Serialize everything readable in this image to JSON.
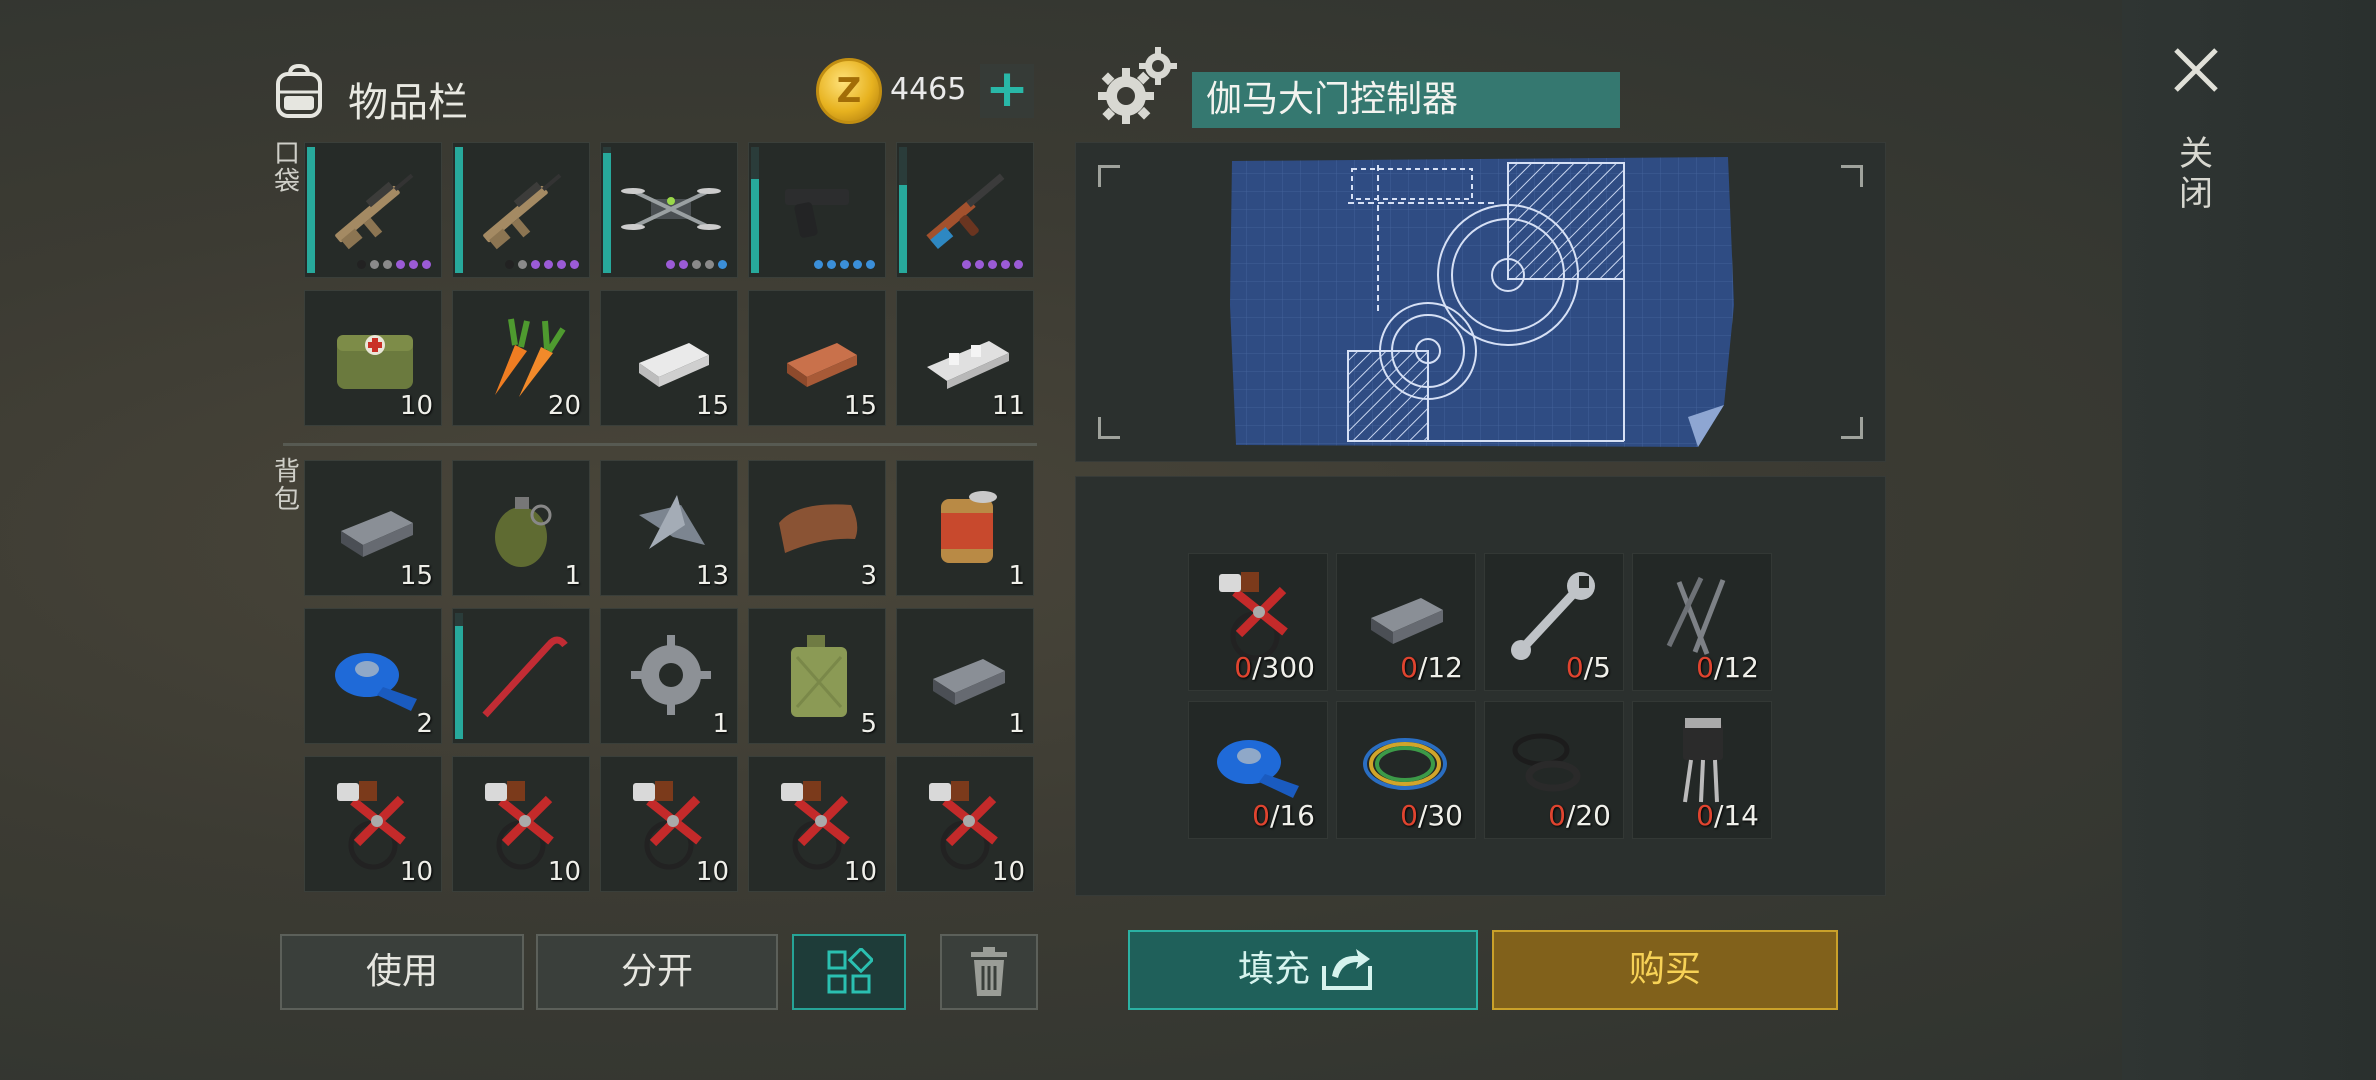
{
  "inventory": {
    "title": "物品栏",
    "currency": {
      "icon": "gold-coin-icon",
      "symbol": "Z",
      "amount": "4465",
      "add_icon": "plus-icon"
    },
    "pockets": {
      "label": "口袋",
      "items": [
        {
          "icon": "assault-rifle-icon",
          "count": "",
          "durability": 1.0,
          "rarity_dots": [
            "#222222",
            "#8a8a8a",
            "#8a8a8a",
            "#9b5bd6",
            "#9b5bd6",
            "#9b5bd6"
          ]
        },
        {
          "icon": "assault-rifle-icon",
          "count": "",
          "durability": 1.0,
          "rarity_dots": [
            "#222222",
            "#8a8a8a",
            "#9b5bd6",
            "#9b5bd6",
            "#9b5bd6",
            "#9b5bd6"
          ]
        },
        {
          "icon": "drone-icon",
          "count": "",
          "durability": 0.95,
          "rarity_dots": [
            "#9b5bd6",
            "#9b5bd6",
            "#8a8a8a",
            "#8a8a8a",
            "#3b8fd9"
          ]
        },
        {
          "icon": "pistol-icon",
          "count": "",
          "durability": 0.75,
          "rarity_dots": [
            "#3b8fd9",
            "#3b8fd9",
            "#3b8fd9",
            "#3b8fd9",
            "#3b8fd9"
          ]
        },
        {
          "icon": "ak-rifle-icon",
          "count": "",
          "durability": 0.7,
          "rarity_dots": [
            "#9b5bd6",
            "#9b5bd6",
            "#9b5bd6",
            "#9b5bd6",
            "#9b5bd6"
          ]
        },
        {
          "icon": "medical-bag-icon",
          "count": "10"
        },
        {
          "icon": "carrot-icon",
          "count": "20"
        },
        {
          "icon": "silver-ingot-icon",
          "count": "15"
        },
        {
          "icon": "copper-ingot-icon",
          "count": "15"
        },
        {
          "icon": "aluminum-ingot-icon",
          "count": "11"
        }
      ]
    },
    "backpack": {
      "label": "背包",
      "items": [
        {
          "icon": "iron-ingot-icon",
          "count": "15"
        },
        {
          "icon": "grenade-icon",
          "count": "1"
        },
        {
          "icon": "metal-scraps-icon",
          "count": "13"
        },
        {
          "icon": "leather-icon",
          "count": "3"
        },
        {
          "icon": "canned-food-icon",
          "count": "1"
        },
        {
          "icon": "blue-tape-icon",
          "count": "2"
        },
        {
          "icon": "crowbar-icon",
          "count": "",
          "durability": 0.9
        },
        {
          "icon": "gear-part-icon",
          "count": "1"
        },
        {
          "icon": "fuel-canister-icon",
          "count": "5"
        },
        {
          "icon": "iron-ingot-icon",
          "count": "1"
        },
        {
          "icon": "electrical-kit-icon",
          "count": "10"
        },
        {
          "icon": "electrical-kit-icon",
          "count": "10"
        },
        {
          "icon": "electrical-kit-icon",
          "count": "10"
        },
        {
          "icon": "electrical-kit-icon",
          "count": "10"
        },
        {
          "icon": "electrical-kit-icon",
          "count": "10"
        }
      ]
    },
    "buttons": {
      "use": "使用",
      "split": "分开",
      "grid_icon": "grid-view-icon",
      "trash_icon": "trash-icon"
    }
  },
  "craft": {
    "icon": "gears-icon",
    "title": "伽马大门控制器",
    "blueprint_icon": "blueprint-icon",
    "requirements": [
      {
        "icon": "electrical-kit-icon",
        "have": "0",
        "need": "/300"
      },
      {
        "icon": "iron-ingot-icon",
        "have": "0",
        "need": "/12"
      },
      {
        "icon": "wrench-icon",
        "have": "0",
        "need": "/5"
      },
      {
        "icon": "nails-icon",
        "have": "0",
        "need": "/12"
      },
      {
        "icon": "blue-tape-icon",
        "have": "0",
        "need": "/16"
      },
      {
        "icon": "wires-icon",
        "have": "0",
        "need": "/30"
      },
      {
        "icon": "rubber-rings-icon",
        "have": "0",
        "need": "/20"
      },
      {
        "icon": "transistor-icon",
        "have": "0",
        "need": "/14"
      }
    ],
    "fill_label": "填充",
    "fill_icon": "fill-arrow-icon",
    "buy_label": "购买"
  },
  "close": {
    "icon": "close-icon",
    "label": "关闭"
  },
  "colors": {
    "accent": "#27a99c",
    "buy": "#caa12a",
    "missing": "#e0442f"
  }
}
